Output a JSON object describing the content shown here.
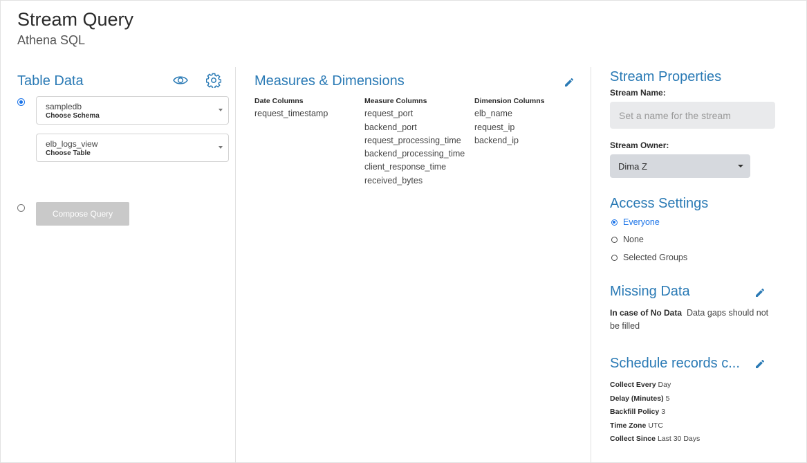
{
  "header": {
    "title": "Stream Query",
    "subtitle": "Athena SQL"
  },
  "table_data": {
    "title": "Table Data",
    "icons": [
      "eye-icon",
      "gear-icon"
    ],
    "schema_select": {
      "value": "sampledb",
      "hint": "Choose Schema"
    },
    "table_select": {
      "value": "elb_logs_view",
      "hint": "Choose Table"
    },
    "compose_button": "Compose Query"
  },
  "measures": {
    "title": "Measures & Dimensions",
    "date_columns": {
      "header": "Date Columns",
      "items": [
        "request_timestamp"
      ]
    },
    "measure_columns": {
      "header": "Measure Columns",
      "items": [
        "request_port",
        "backend_port",
        "request_processing_time",
        "backend_processing_time",
        "client_response_time",
        "received_bytes"
      ]
    },
    "dimension_columns": {
      "header": "Dimension Columns",
      "items": [
        "elb_name",
        "request_ip",
        "backend_ip"
      ]
    }
  },
  "stream_properties": {
    "title": "Stream Properties",
    "name_label": "Stream Name:",
    "name_placeholder": "Set a name for the stream",
    "owner_label": "Stream Owner:",
    "owner_value": "Dima Z"
  },
  "access_settings": {
    "title": "Access Settings",
    "options": [
      "Everyone",
      "None",
      "Selected Groups"
    ],
    "selected": "Everyone"
  },
  "missing_data": {
    "title": "Missing Data",
    "label": "In case of No Data",
    "value": "Data gaps should not be filled"
  },
  "schedule": {
    "title": "Schedule records c...",
    "rows": [
      {
        "key": "Collect Every",
        "value": "Day"
      },
      {
        "key": "Delay (Minutes)",
        "value": "5"
      },
      {
        "key": "Backfill Policy",
        "value": "3"
      },
      {
        "key": "Time Zone",
        "value": "UTC"
      },
      {
        "key": "Collect Since",
        "value": "Last 30 Days"
      }
    ]
  },
  "colors": {
    "accent": "#2a7ab5",
    "selected": "#1a73e8",
    "disabled_button": "#c9c9c9"
  }
}
